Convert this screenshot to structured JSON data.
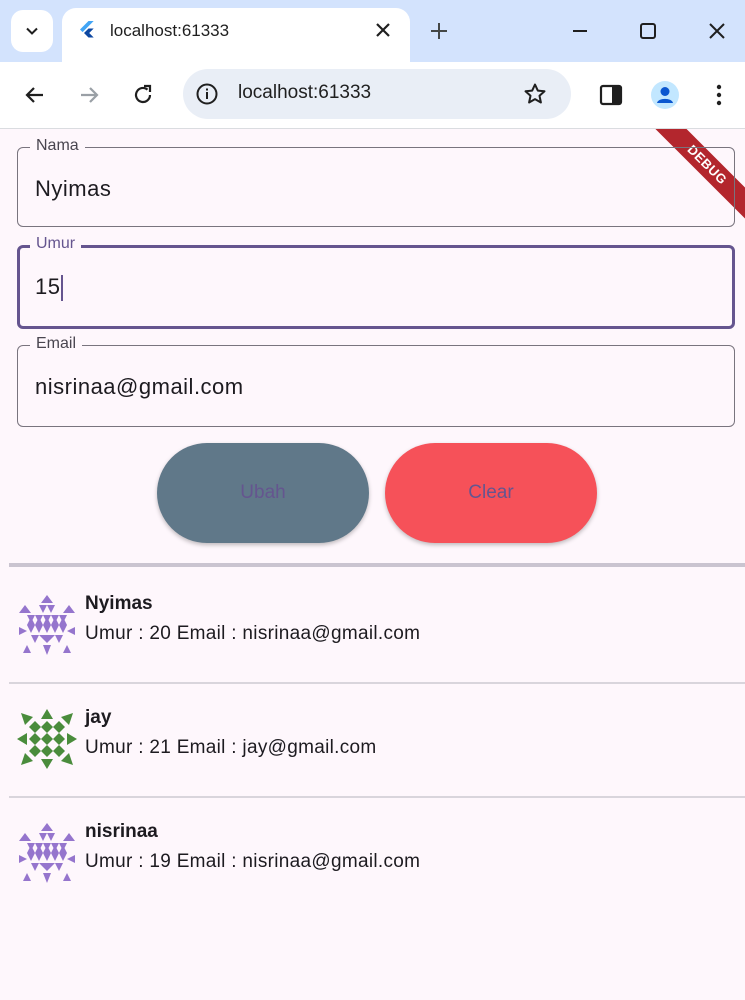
{
  "browser": {
    "tab_title": "localhost:61333",
    "address": "localhost:61333"
  },
  "app": {
    "debug_banner": "DEBUG",
    "form": {
      "name": {
        "label": "Nama",
        "value": "Nyimas"
      },
      "age": {
        "label": "Umur",
        "value": "15"
      },
      "email": {
        "label": "Email",
        "value": "nisrinaa@gmail.com"
      }
    },
    "buttons": {
      "update_label": "Ubah",
      "clear_label": "Clear"
    },
    "users": [
      {
        "name": "Nyimas",
        "detail": "Umur : 20 Email : nisrinaa@gmail.com",
        "avatar_color": "#9575cd"
      },
      {
        "name": "jay",
        "detail": "Umur : 21 Email : jay@gmail.com",
        "avatar_color": "#4a8c3c"
      },
      {
        "name": "nisrinaa",
        "detail": "Umur : 19 Email : nisrinaa@gmail.com",
        "avatar_color": "#9575cd"
      }
    ]
  },
  "colors": {
    "accent": "#65558f",
    "update_button": "#607889",
    "clear_button": "#f65159",
    "tab_strip": "#d3e3fd"
  }
}
